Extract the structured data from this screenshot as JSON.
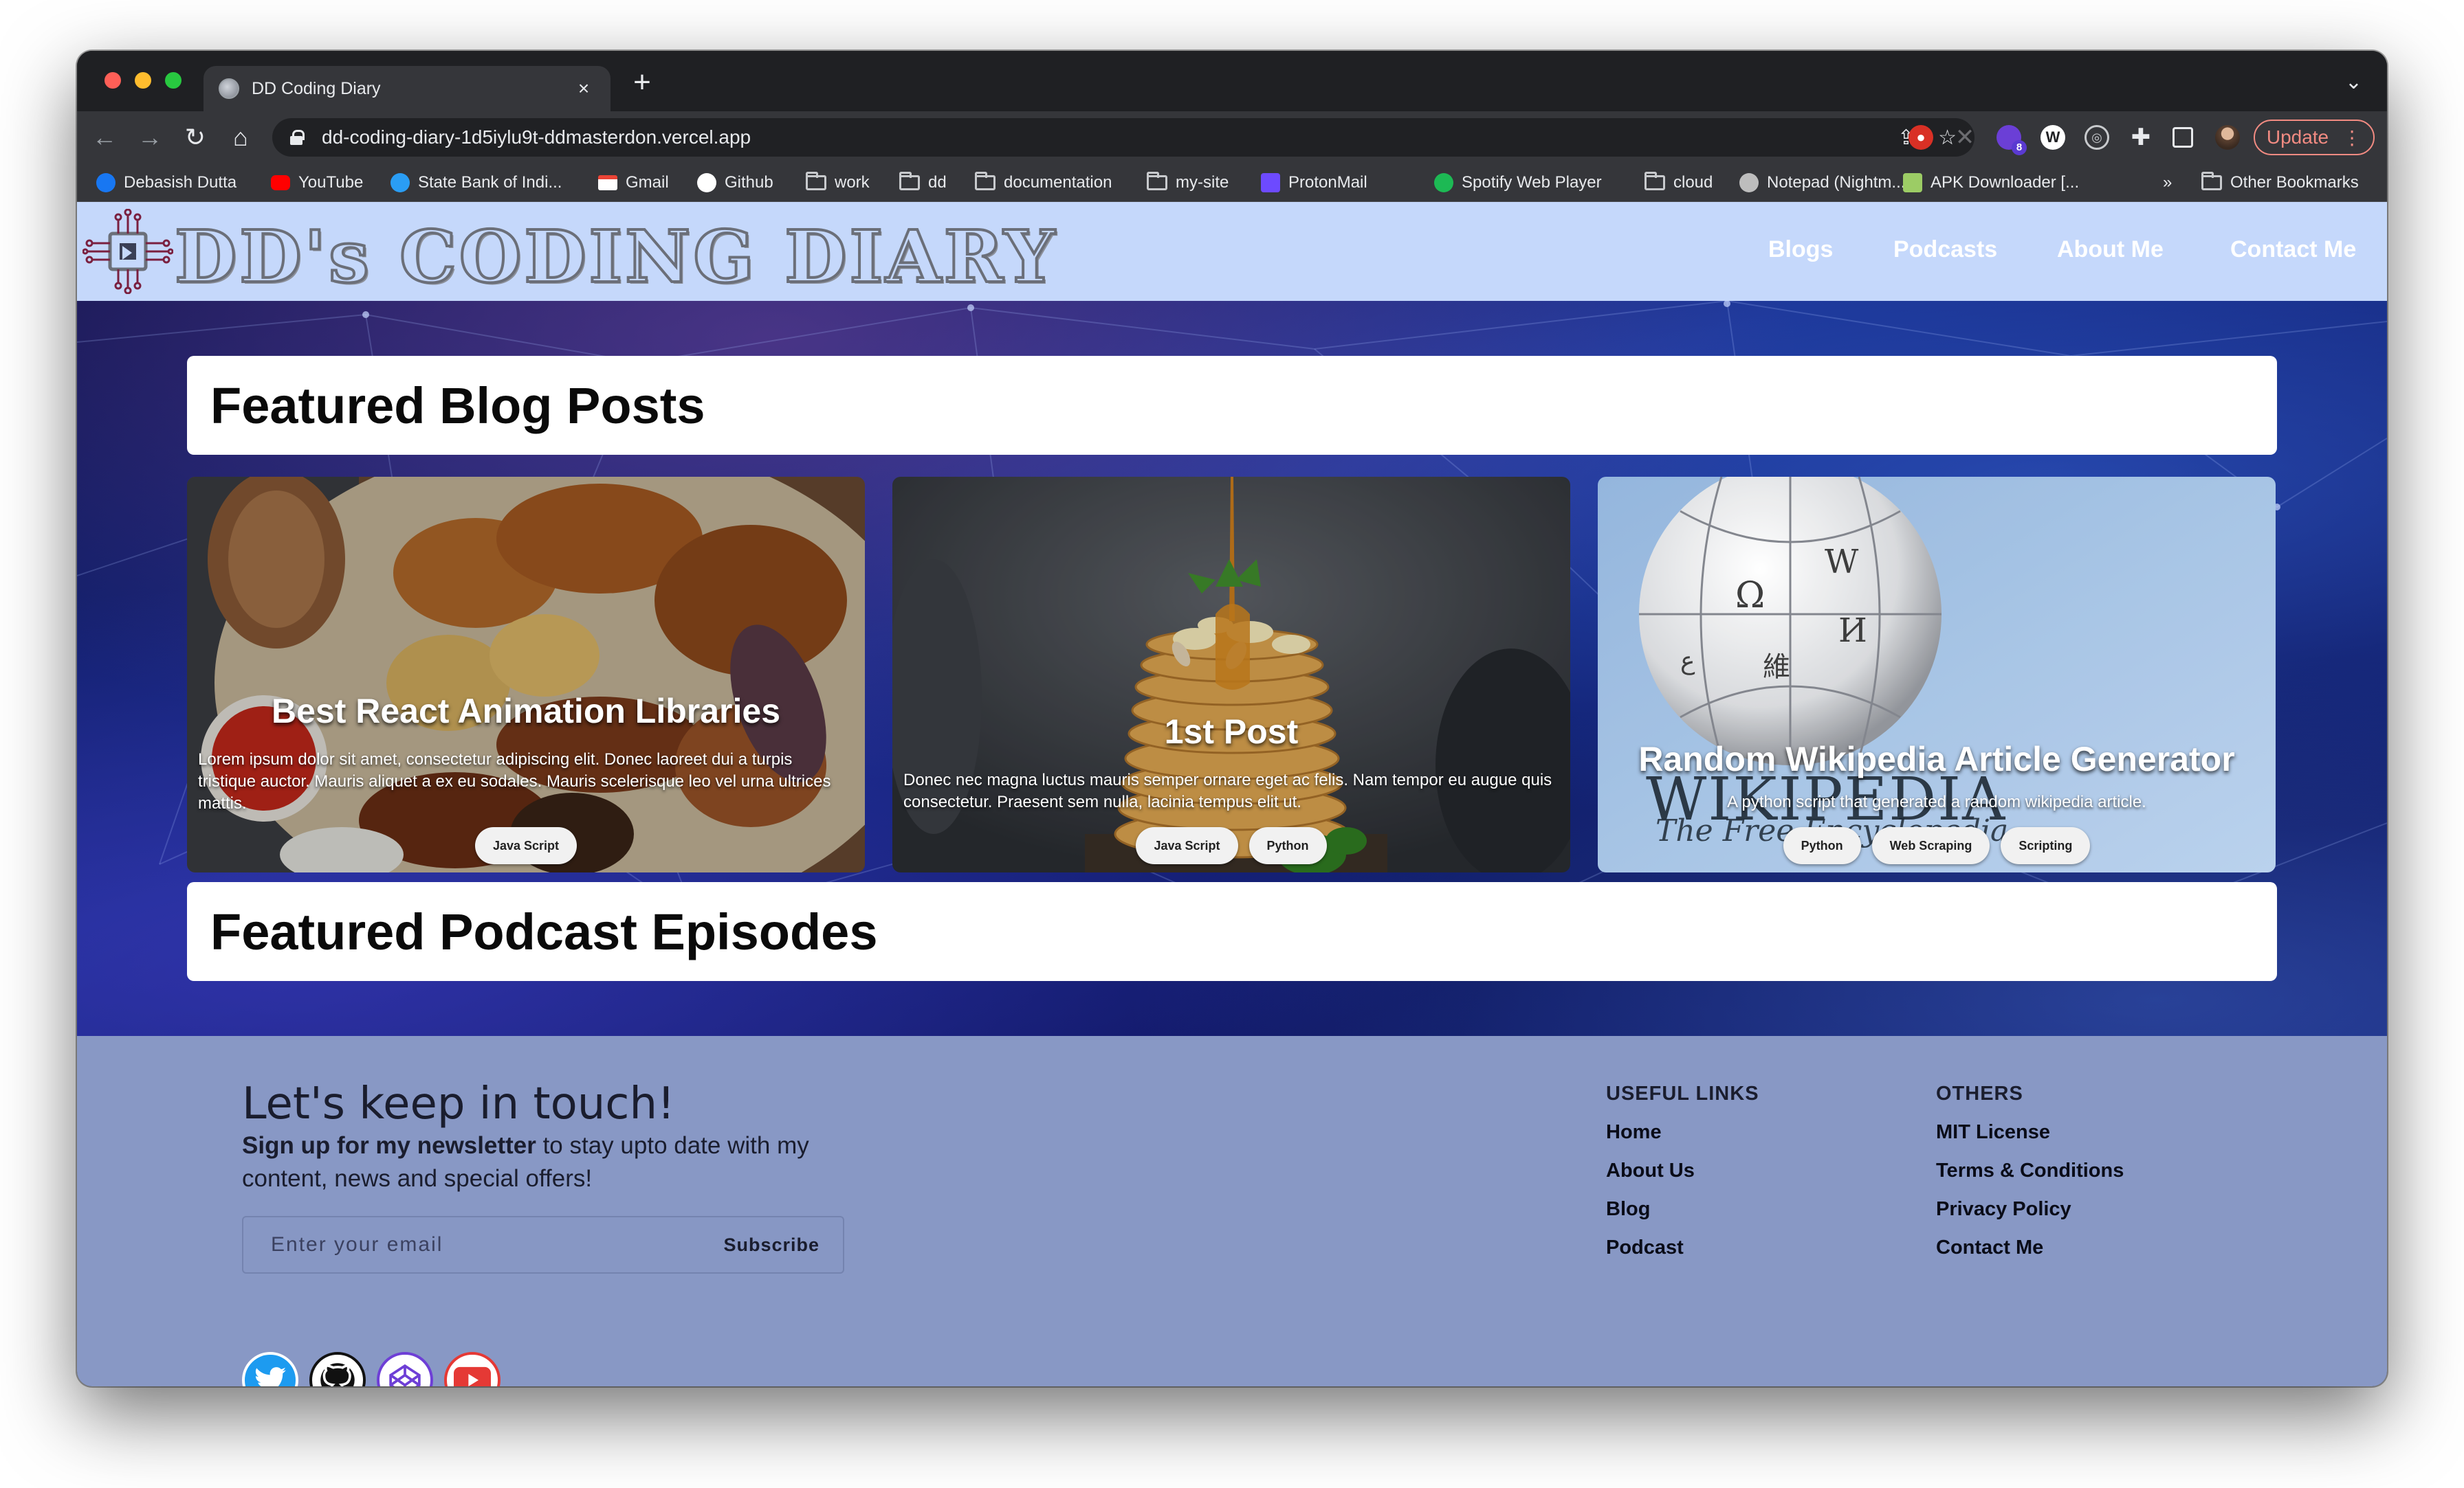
{
  "browser": {
    "tab_title": "DD Coding Diary",
    "tab_close": "×",
    "new_tab": "+",
    "tab_search": "⌄",
    "url": "dd-coding-diary-1d5iylu9t-ddmasterdon.vercel.app",
    "nav": {
      "back": "←",
      "forward": "→",
      "reload": "↻",
      "home": "⌂"
    },
    "omnibox_icons": {
      "share": "⇪",
      "bookmark": "☆"
    },
    "update_label": "Update",
    "update_menu": "⋮",
    "extension_badge": "8",
    "bookmarks_overflow": "»",
    "bookmarks": [
      {
        "label": "Debasish Dutta",
        "icon": "facebook-icon",
        "color": "#1877f2"
      },
      {
        "label": "YouTube",
        "icon": "youtube-icon",
        "color": "#ff0000"
      },
      {
        "label": "State Bank of Indi...",
        "icon": "sbi-icon",
        "color": "#2a9df4"
      },
      {
        "label": "Gmail",
        "icon": "gmail-icon",
        "color": "#ea4335"
      },
      {
        "label": "Github",
        "icon": "github-icon",
        "color": "#ffffff"
      },
      {
        "label": "work",
        "icon": "folder-icon"
      },
      {
        "label": "dd",
        "icon": "folder-icon"
      },
      {
        "label": "documentation",
        "icon": "folder-icon"
      },
      {
        "label": "my-site",
        "icon": "folder-icon"
      },
      {
        "label": "ProtonMail",
        "icon": "protonmail-icon",
        "color": "#6d4aff"
      },
      {
        "label": "Spotify Web Player",
        "icon": "spotify-icon",
        "color": "#1db954"
      },
      {
        "label": "cloud",
        "icon": "folder-icon"
      },
      {
        "label": "Notepad (Nightm...",
        "icon": "notepad-icon",
        "color": "#bdbdbd"
      },
      {
        "label": "APK Downloader [...",
        "icon": "apk-icon",
        "color": "#9ccc65"
      }
    ],
    "other_bookmarks": "Other Bookmarks"
  },
  "site": {
    "logo_text": "DD's CODING DIARY",
    "nav": [
      "Blogs",
      "Podcasts",
      "About Me",
      "Contact Me"
    ],
    "sections": {
      "blogs_heading": "Featured Blog Posts",
      "podcasts_heading": "Featured Podcast Episodes"
    },
    "cards": [
      {
        "title": "Best React Animation Libraries",
        "description": "Lorem ipsum dolor sit amet, consectetur adipiscing elit. Donec laoreet dui a turpis tristique auctor. Mauris aliquet a ex eu sodales. Mauris scelerisque leo vel urna ultrices mattis.",
        "tags": [
          "Java Script"
        ]
      },
      {
        "title": "1st Post",
        "description": "Donec nec magna luctus mauris semper ornare eget ac felis. Nam tempor eu augue quis consectetur. Praesent sem nulla, lacinia tempus elit ut.",
        "tags": [
          "Java Script",
          "Python"
        ]
      },
      {
        "title": "Random Wikipedia Article Generator",
        "description": "A python script that generated a random wikipedia article.",
        "image_text": "WIKIPEDIA",
        "image_subtext": "The Free Encyclopedia",
        "tags": [
          "Python",
          "Web Scraping",
          "Scripting"
        ]
      }
    ]
  },
  "footer": {
    "heading": "Let's keep in touch!",
    "subtitle_bold": "Sign up for my newsletter",
    "subtitle_rest": " to stay upto date with my content, news and special offers!",
    "email_placeholder": "Enter your email",
    "subscribe_label": "Subscribe",
    "useful_links_heading": "USEFUL LINKS",
    "useful_links": [
      "Home",
      "About Us",
      "Blog",
      "Podcast"
    ],
    "others_heading": "OTHERS",
    "others_links": [
      "MIT License",
      "Terms & Conditions",
      "Privacy Policy",
      "Contact Me"
    ],
    "social": [
      "twitter-icon",
      "github-icon",
      "codepen-icon",
      "youtube-icon"
    ]
  },
  "colors": {
    "header_bg": "#c5d8fb",
    "footer_bg": "#8898c5",
    "hero_bg": "#152a86"
  }
}
